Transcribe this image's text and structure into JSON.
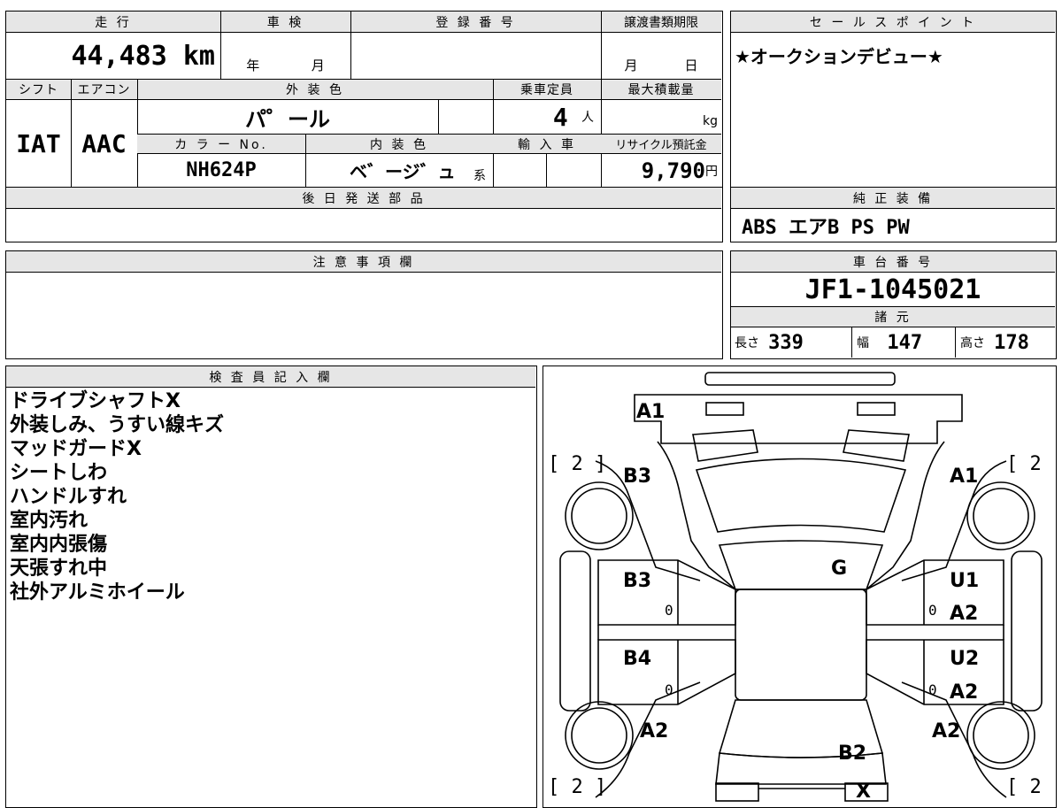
{
  "vehicle_info": {
    "mileage_header": "走 行",
    "mileage_value": "44,483",
    "mileage_unit": "km",
    "inspection_header": "車 検",
    "inspection_year": "年",
    "inspection_month": "月",
    "registration_header": "登 録 番 号",
    "transfer_header": "譲渡書類期限",
    "transfer_month": "月",
    "transfer_day": "日",
    "shift_header": "シフト",
    "shift_value": "IAT",
    "aircon_header": "エアコン",
    "aircon_value": "AAC",
    "exterior_color_header": "外 装 色",
    "exterior_color_value": "パ゜ール",
    "capacity_header": "乗車定員",
    "capacity_value": "4",
    "capacity_unit": "人",
    "max_load_header": "最大積載量",
    "max_load_unit": "kg",
    "color_no_header": "カ ラ ー No.",
    "color_no_value": "NH624P",
    "interior_color_header": "内 装 色",
    "interior_color_value": "ベ゛ージ゛ュ",
    "interior_color_suffix": "系",
    "import_header": "輸 入 車",
    "recycle_header": "リサイクル預託金",
    "recycle_value": "9,790",
    "recycle_unit": "円",
    "later_parts_header": "後 日 発 送 部 品"
  },
  "sales_point": {
    "header": "セ ー ル ス ポ イ ン ト",
    "text": "★オークションデビュー★"
  },
  "standard_equipment": {
    "header": "純 正 装 備",
    "text": "ABS エアB PS PW"
  },
  "notes": {
    "header": "注 意 事 項 欄"
  },
  "chassis": {
    "header": "車 台 番 号",
    "value": "JF1-1045021"
  },
  "specs": {
    "header": "諸 元",
    "length_label": "長さ",
    "length_value": "339",
    "width_label": "幅",
    "width_value": "147",
    "height_label": "高さ",
    "height_value": "178"
  },
  "inspector": {
    "header": "検 査 員 記 入 欄",
    "lines": [
      "ドライブシャフトX",
      "外装しみ、うすい線キズ",
      "マッドガードX",
      "シートしわ",
      "ハンドルすれ",
      "室内汚れ",
      "室内内張傷",
      "天張すれ中",
      "社外アルミホイール"
    ]
  },
  "diagram": {
    "labels": {
      "front_bumper": "A1",
      "left_front_fender": "B3",
      "right_front_fender": "A1",
      "windshield": "G",
      "left_front_door": "B3",
      "right_front_door_1": "U1",
      "right_front_door_2": "A2",
      "left_rear_door": "B4",
      "right_rear_door_1": "U2",
      "right_rear_door_2": "A2",
      "left_rear_fender": "A2",
      "right_rear_fender": "A2",
      "rear": "B2",
      "rear_mark": "X"
    },
    "tire_marks": {
      "front_left": "[ 2 ]",
      "front_right": "[ 2 ]",
      "rear_left": "[ 2 ]",
      "rear_right": "[ 2 ]"
    },
    "zeros": [
      "0",
      "0",
      "0",
      "0"
    ]
  }
}
